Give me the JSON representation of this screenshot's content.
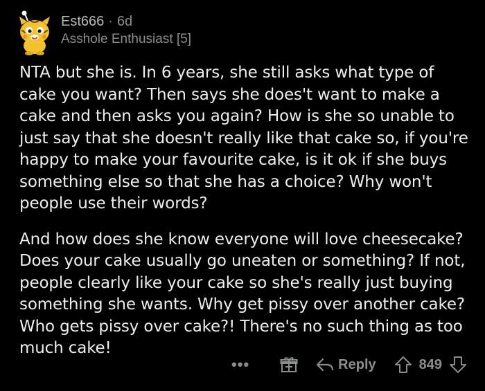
{
  "comment": {
    "author": "Est666",
    "separator": "·",
    "age": "6d",
    "flair": "Asshole Enthusiast [5]",
    "paragraphs": [
      "NTA but she is. In 6 years, she still asks what type of cake you want? Then says she does't want to make a cake and then asks you again? How is she so unable to just say that she doesn't really like that cake so, if you're happy to make your favourite cake, is it ok if she buys something else so that she has a choice? Why won't people use their words?",
      "And how does she know everyone will love cheesecake? Does your cake usually go uneaten or something? If not, people clearly like your cake so she's really just buying something she wants. Why get pissy over another cake? Who gets pissy over cake?! There's no such thing as too much cake!"
    ]
  },
  "actions": {
    "more_label": "•••",
    "award_icon": "gift-icon",
    "reply_label": "Reply",
    "reply_icon": "reply-arrow-icon",
    "upvote_icon": "upvote-arrow-icon",
    "score": "849",
    "downvote_icon": "downvote-arrow-icon"
  },
  "colors": {
    "background": "#000000",
    "text": "#ebeef0",
    "muted": "#8b8e90",
    "avatar_yellow": "#f2c230"
  }
}
